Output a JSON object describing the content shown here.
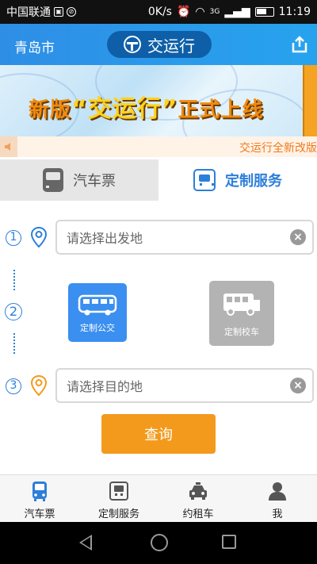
{
  "status_bar": {
    "carrier": "中国联通",
    "speed": "0K/s",
    "network": "3G",
    "time": "11:19"
  },
  "header": {
    "city": "青岛市",
    "app_name": "交运行"
  },
  "banner": {
    "text_left": "新版",
    "text_mid": "“交运行”",
    "text_right": "正式上线"
  },
  "notice": {
    "text": "交运行全新改版"
  },
  "tabs": [
    {
      "label": "汽车票",
      "active": false
    },
    {
      "label": "定制服务",
      "active": true
    }
  ],
  "form": {
    "steps": [
      "①",
      "②",
      "③"
    ],
    "departure": {
      "placeholder": "请选择出发地",
      "value": ""
    },
    "destination": {
      "placeholder": "请选择目的地",
      "value": ""
    },
    "services": [
      {
        "label": "定制公交",
        "enabled": true
      },
      {
        "label": "定制校车",
        "enabled": false
      }
    ],
    "clear_glyph": "×",
    "query_label": "查询"
  },
  "bottom_nav": [
    {
      "label": "汽车票",
      "icon": "bus-icon"
    },
    {
      "label": "定制服务",
      "icon": "custom-service-icon"
    },
    {
      "label": "约租车",
      "icon": "taxi-icon"
    },
    {
      "label": "我",
      "icon": "user-icon"
    }
  ],
  "colors": {
    "primary": "#2d7fd9",
    "accent_orange": "#f39a1c",
    "service_active": "#3a8ff0",
    "service_disabled": "#b3b3b3"
  }
}
